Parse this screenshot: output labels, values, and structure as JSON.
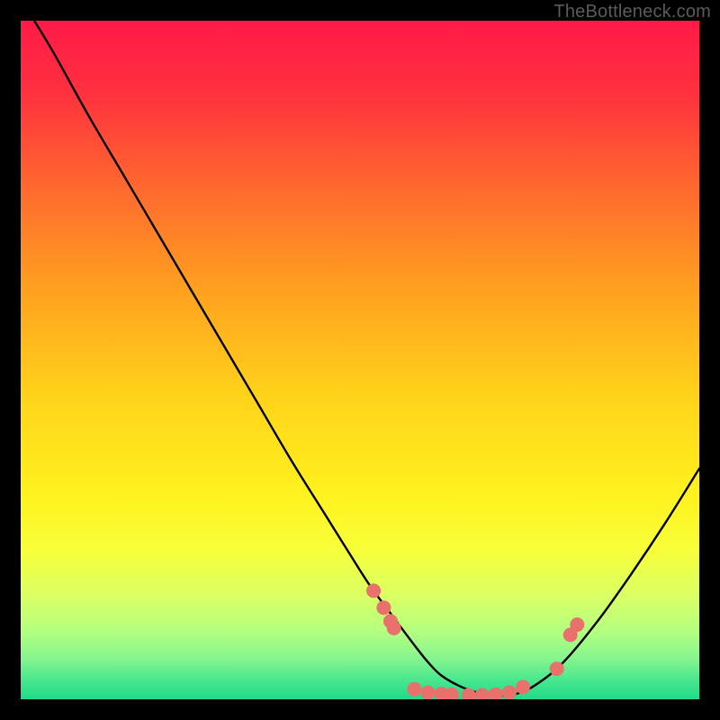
{
  "watermark": "TheBottleneck.com",
  "chart_data": {
    "type": "line",
    "title": "",
    "xlabel": "",
    "ylabel": "",
    "xlim": [
      0,
      100
    ],
    "ylim": [
      0,
      100
    ],
    "series": [
      {
        "name": "bottleneck-curve",
        "x": [
          2,
          5,
          10,
          15,
          20,
          25,
          30,
          35,
          40,
          45,
          50,
          52,
          55,
          58,
          60,
          62,
          65,
          68,
          70,
          73,
          76,
          80,
          85,
          90,
          95,
          100
        ],
        "y": [
          100,
          95,
          86,
          77.5,
          69,
          60.5,
          52,
          43.5,
          35,
          27,
          19,
          16,
          12,
          8,
          5.5,
          3.5,
          1.8,
          0.8,
          0.5,
          0.8,
          2.2,
          5.5,
          11.5,
          18.5,
          26,
          34
        ]
      }
    ],
    "scatter": {
      "name": "highlight-points",
      "color": "#e8716b",
      "points": [
        {
          "x": 52,
          "y": 16
        },
        {
          "x": 53.5,
          "y": 13.5
        },
        {
          "x": 54.5,
          "y": 11.5
        },
        {
          "x": 55,
          "y": 10.5
        },
        {
          "x": 58,
          "y": 1.5
        },
        {
          "x": 60,
          "y": 1.0
        },
        {
          "x": 62,
          "y": 0.8
        },
        {
          "x": 63.5,
          "y": 0.7
        },
        {
          "x": 66,
          "y": 0.6
        },
        {
          "x": 68,
          "y": 0.6
        },
        {
          "x": 70,
          "y": 0.7
        },
        {
          "x": 72,
          "y": 1.0
        },
        {
          "x": 74,
          "y": 1.8
        },
        {
          "x": 79,
          "y": 4.5
        },
        {
          "x": 81,
          "y": 9.5
        },
        {
          "x": 82,
          "y": 11.0
        }
      ]
    },
    "background_gradient": {
      "stops": [
        {
          "offset": 0.0,
          "color": "#ff1a47"
        },
        {
          "offset": 0.1,
          "color": "#ff2f3f"
        },
        {
          "offset": 0.25,
          "color": "#ff6a2e"
        },
        {
          "offset": 0.4,
          "color": "#ffa21f"
        },
        {
          "offset": 0.55,
          "color": "#ffd21a"
        },
        {
          "offset": 0.7,
          "color": "#fff21e"
        },
        {
          "offset": 0.78,
          "color": "#f7ff3a"
        },
        {
          "offset": 0.85,
          "color": "#d9ff66"
        },
        {
          "offset": 0.9,
          "color": "#b3ff80"
        },
        {
          "offset": 0.94,
          "color": "#86f58e"
        },
        {
          "offset": 0.97,
          "color": "#4ce88f"
        },
        {
          "offset": 1.0,
          "color": "#1fd989"
        }
      ]
    }
  }
}
